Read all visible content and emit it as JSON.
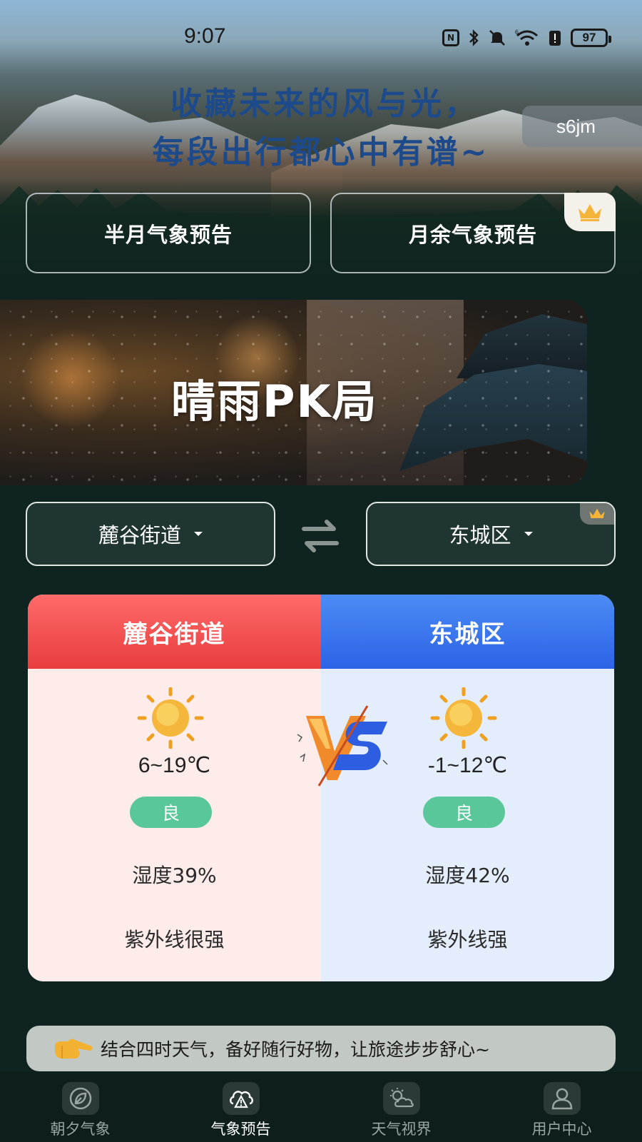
{
  "status_bar": {
    "time": "9:07",
    "battery": "97",
    "icons": [
      "nfc-icon",
      "bluetooth-icon",
      "mute-icon",
      "wifi-icon",
      "battery-saver-icon",
      "battery-icon"
    ]
  },
  "hero": {
    "headline_line1": "收藏未来的风与光，",
    "headline_line2": "每段出行都心中有谱~",
    "user_chip": "s6jm"
  },
  "forecast_buttons": {
    "half_month": "半月气象预告",
    "month_plus": "月余气象预告"
  },
  "banner": {
    "title": "晴雨PK局"
  },
  "selectors": {
    "left": "麓谷街道",
    "right": "东城区"
  },
  "compare": {
    "left": {
      "name": "麓谷街道",
      "weather_icon": "sun-icon",
      "temp": "6~19℃",
      "aqi": "良",
      "humidity": "湿度39%",
      "uv": "紫外线很强"
    },
    "right": {
      "name": "东城区",
      "weather_icon": "sun-icon",
      "temp": "-1~12℃",
      "aqi": "良",
      "humidity": "湿度42%",
      "uv": "紫外线强"
    }
  },
  "tip": {
    "text": "结合四时天气，备好随行好物，让旅途步步舒心~"
  },
  "nav": {
    "items": [
      {
        "label": "朝夕气象",
        "icon": "leaf-icon"
      },
      {
        "label": "气象预告",
        "icon": "cloud-alert-icon"
      },
      {
        "label": "天气视界",
        "icon": "sun-cloud-icon"
      },
      {
        "label": "用户中心",
        "icon": "user-icon"
      }
    ],
    "active_index": 1
  },
  "colors": {
    "left_header": "#e83d3d",
    "right_header": "#2b63e6",
    "aqi_good": "#5ac79a",
    "headline": "#1d4a8a"
  }
}
